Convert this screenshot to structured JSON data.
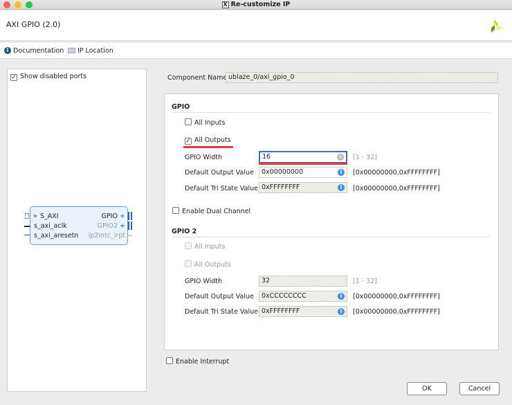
{
  "window": {
    "title": "Re-customize IP"
  },
  "header": {
    "title": "AXI GPIO (2.0)"
  },
  "toolbar": {
    "documentation": "Documentation",
    "ip_location": "IP Location"
  },
  "left_panel": {
    "show_disabled_ports": "Show disabled ports",
    "show_disabled_checked": true,
    "block": {
      "left_ports": [
        "S_AXI",
        "s_axi_aclk",
        "s_axi_aresetn"
      ],
      "right_ports": [
        "GPIO",
        "GPIO2",
        "ip2intc_irpt"
      ]
    }
  },
  "component": {
    "label": "Component Name",
    "value": "ublaze_0/axi_gpio_0"
  },
  "gpio": {
    "title": "GPIO",
    "all_inputs": "All Inputs",
    "all_inputs_checked": false,
    "all_outputs": "All Outputs",
    "all_outputs_checked": true,
    "width_label": "GPIO Width",
    "width_value": "16",
    "width_range": "[1 - 32]",
    "dout_label": "Default Output Value",
    "dout_value": "0x00000000",
    "dout_range": "[0x00000000,0xFFFFFFFF]",
    "tri_label": "Default Tri State Value",
    "tri_value": "0xFFFFFFFF",
    "tri_range": "[0x00000000,0xFFFFFFFF]"
  },
  "dual_channel": {
    "label": "Enable Dual Channel",
    "checked": false
  },
  "gpio2": {
    "title": "GPIO 2",
    "all_inputs": "All Inputs",
    "all_outputs": "All Outputs",
    "width_label": "GPIO Width",
    "width_value": "32",
    "width_range": "[1 - 32]",
    "dout_label": "Default Output Value",
    "dout_value": "0xCCCCCCCC",
    "dout_range": "[0x00000000,0xFFFFFFFF]",
    "tri_label": "Default Tri State Value",
    "tri_value": "0xFFFFFFFF",
    "tri_range": "[0x00000000,0xFFFFFFFF]"
  },
  "interrupt": {
    "label": "Enable Interrupt",
    "checked": false
  },
  "buttons": {
    "ok": "OK",
    "cancel": "Cancel"
  },
  "colors": {
    "highlight": "#e53935",
    "focus": "#3c6fc4",
    "info": "#3b8ee0"
  }
}
